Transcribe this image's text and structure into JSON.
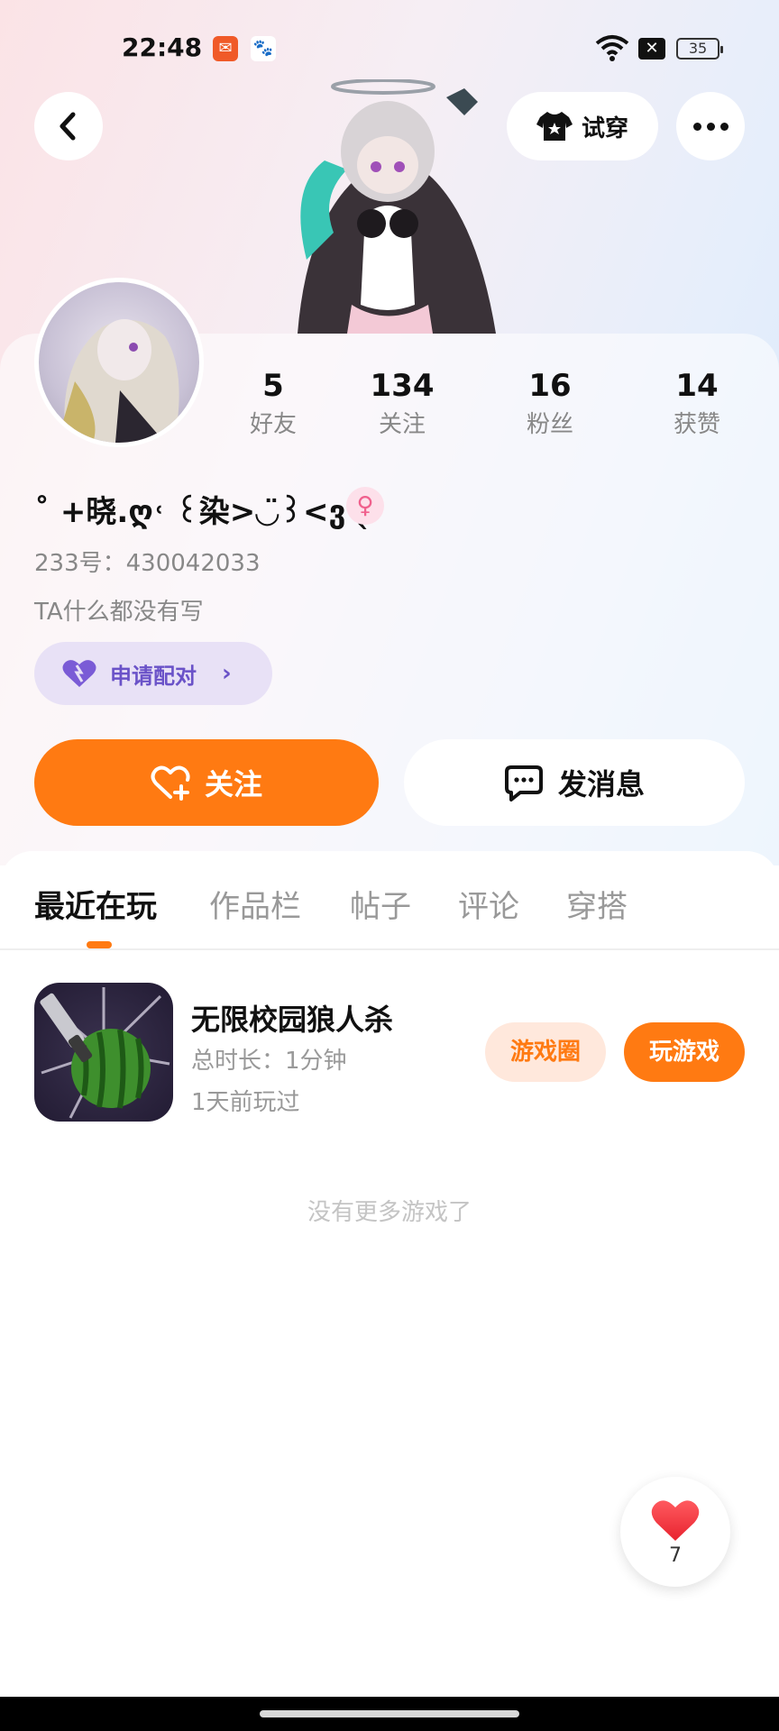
{
  "status_bar": {
    "time": "22:48",
    "battery": "35",
    "icons": [
      "app-notification-icon",
      "baidu-icon",
      "wifi-icon",
      "sim-off-icon",
      "battery-icon"
    ]
  },
  "header": {
    "try_on_label": "试穿",
    "icons": [
      "back-arrow-icon",
      "tshirt-icon",
      "more-dots-icon"
    ]
  },
  "profile": {
    "stats": [
      {
        "value": "5",
        "label": "好友"
      },
      {
        "value": "134",
        "label": "关注"
      },
      {
        "value": "16",
        "label": "粉丝"
      },
      {
        "value": "14",
        "label": "获赞"
      }
    ],
    "username": "˚ +晓.ღ˓ ꒰染>◡̈꒱<ვ ˎ",
    "gender": "♀",
    "id_text": "233号：430042033",
    "bio": "TA什么都没有写",
    "pair_label": "申请配对",
    "follow_label": "关注",
    "message_label": "发消息"
  },
  "tabs": [
    {
      "label": "最近在玩",
      "active": true
    },
    {
      "label": "作品栏",
      "active": false
    },
    {
      "label": "帖子",
      "active": false
    },
    {
      "label": "评论",
      "active": false
    },
    {
      "label": "穿搭",
      "active": false
    }
  ],
  "games": [
    {
      "title": "无限校园狼人杀",
      "playtime": "总时长：1分钟",
      "last_played": "1天前玩过",
      "circle_label": "游戏圈",
      "play_label": "玩游戏",
      "icon": "watermelon-knife-icon"
    }
  ],
  "empty_text": "没有更多游戏了",
  "like_fab": {
    "count": "7"
  },
  "colors": {
    "accent": "#ff7a12",
    "pair": "#6a52c8",
    "pair_bg": "#e8e1f6",
    "gender": "#f0608d"
  }
}
